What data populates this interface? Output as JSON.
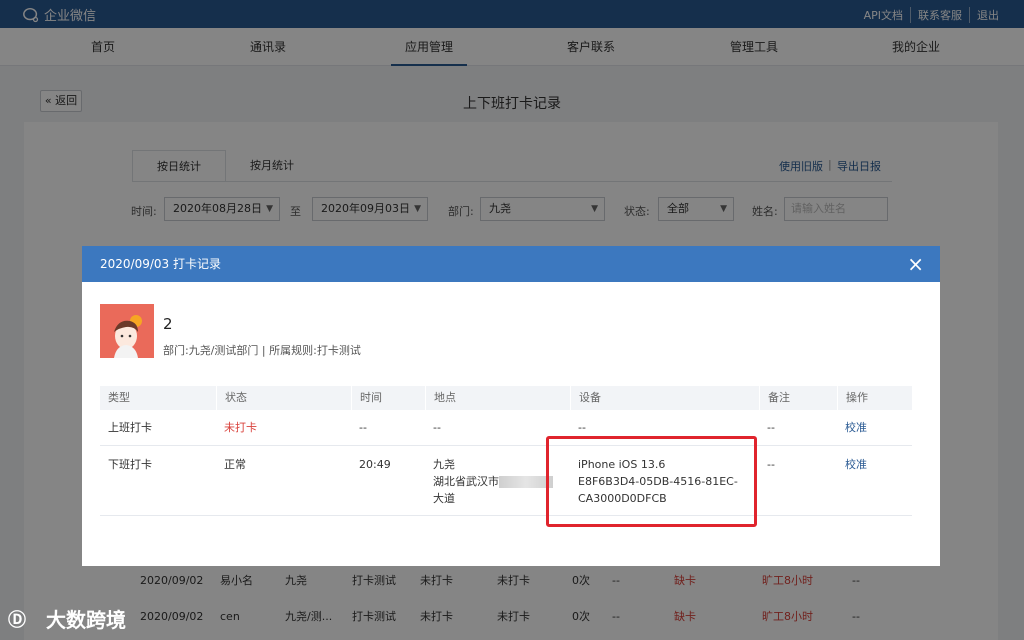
{
  "app": {
    "name": "企业微信"
  },
  "toplinks": [
    "API文档",
    "联系客服",
    "退出"
  ],
  "nav": [
    "首页",
    "通讯录",
    "应用管理",
    "客户联系",
    "管理工具",
    "我的企业"
  ],
  "page": {
    "back_label": "« 返回",
    "title": "上下班打卡记录"
  },
  "tabs": [
    "按日统计",
    "按月统计"
  ],
  "links": {
    "old_version": "使用旧版",
    "export": "导出日报"
  },
  "filters": {
    "time_label": "时间:",
    "start_date": "2020年08月28日",
    "to": "至",
    "end_date": "2020年09月03日",
    "dept_label": "部门:",
    "dept_value": "九尧",
    "status_label": "状态:",
    "status_value": "全部",
    "name_label": "姓名:",
    "name_placeholder": "请输入姓名"
  },
  "background_rows": [
    [
      "2020/09/02",
      "易小名",
      "九尧",
      "打卡测试",
      "未打卡",
      "未打卡",
      "0次",
      "--",
      "缺卡",
      "旷工8小时",
      "--"
    ],
    [
      "2020/09/02",
      "cen",
      "九尧/测...",
      "打卡测试",
      "未打卡",
      "未打卡",
      "0次",
      "--",
      "缺卡",
      "旷工8小时",
      "--"
    ]
  ],
  "modal": {
    "title": "2020/09/03 打卡记录",
    "close": "×",
    "user": {
      "name": "2",
      "info": "部门:九尧/测试部门 | 所属规则:打卡测试"
    },
    "columns": [
      "类型",
      "状态",
      "时间",
      "地点",
      "设备",
      "备注",
      "操作"
    ],
    "rows": [
      {
        "type": "上班打卡",
        "status": "未打卡",
        "time": "--",
        "loc1": "--",
        "loc2": "",
        "loc3": "",
        "dev1": "--",
        "dev2": "",
        "dev3": "",
        "note": "--",
        "action": "校准"
      },
      {
        "type": "下班打卡",
        "status": "正常",
        "time": "20:49",
        "loc1": "九尧",
        "loc2": "湖北省武汉市",
        "loc3": "大道",
        "dev1": "iPhone iOS 13.6",
        "dev2": "E8F6B3D4-05DB-4516-81EC-",
        "dev3": "CA3000D0DFCB",
        "note": "--",
        "action": "校准"
      }
    ]
  },
  "watermark": "大数跨境",
  "colors": {
    "brand": "#2a5a93",
    "modal_header": "#3c78bf",
    "alert_red": "#d9413b",
    "highlight_box": "#e0242d"
  }
}
